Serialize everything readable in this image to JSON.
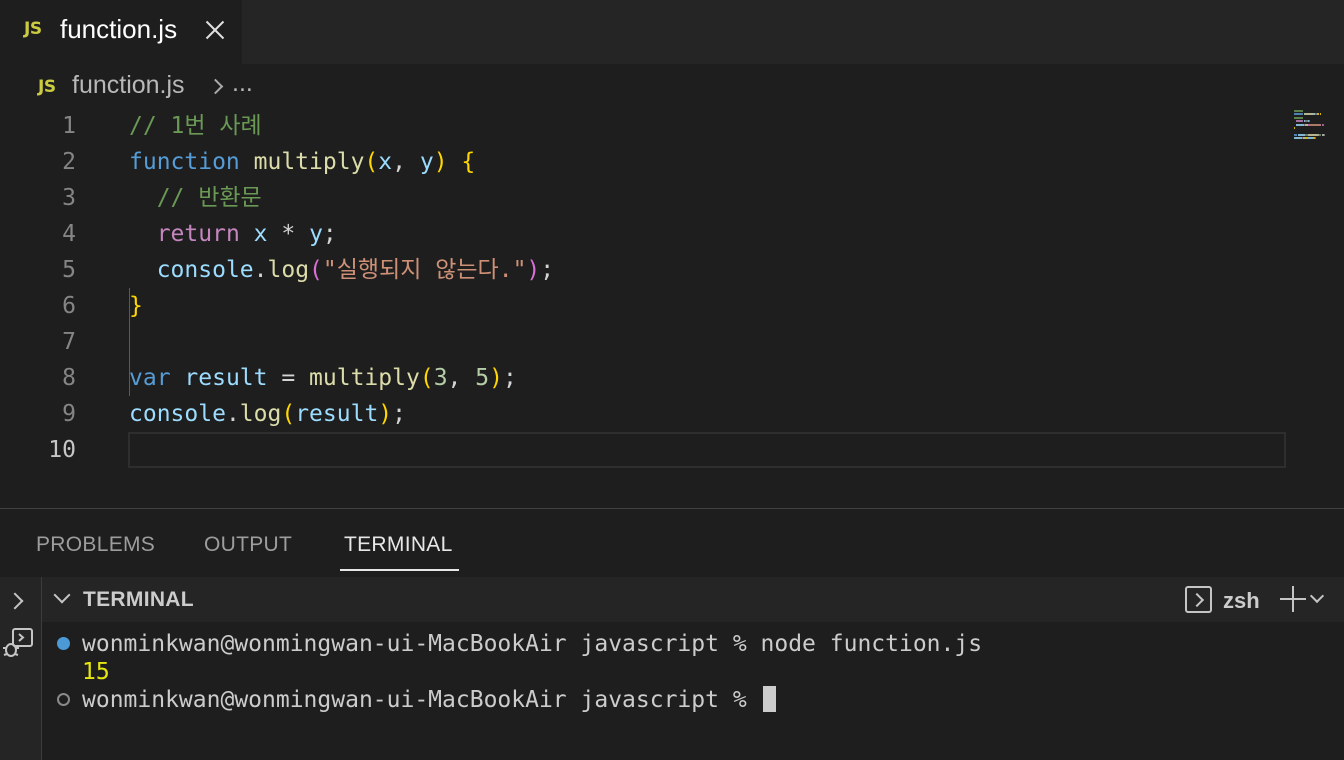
{
  "tab": {
    "badge": "JS",
    "title": "function.js"
  },
  "breadcrumb": {
    "badge": "JS",
    "file": "function.js",
    "more": "..."
  },
  "editor": {
    "line_numbers": [
      "1",
      "2",
      "3",
      "4",
      "5",
      "6",
      "7",
      "8",
      "9",
      "10"
    ],
    "active_line": "10",
    "lines": [
      [
        {
          "t": "// 1번 사례",
          "c": "comment"
        }
      ],
      [
        {
          "t": "function",
          "c": "keyword"
        },
        {
          "t": " ",
          "c": "text"
        },
        {
          "t": "multiply",
          "c": "func"
        },
        {
          "t": "(",
          "c": "brace"
        },
        {
          "t": "x",
          "c": "param"
        },
        {
          "t": ", ",
          "c": "text"
        },
        {
          "t": "y",
          "c": "param"
        },
        {
          "t": ")",
          "c": "brace"
        },
        {
          "t": " ",
          "c": "text"
        },
        {
          "t": "{",
          "c": "brace"
        }
      ],
      [
        {
          "t": "  // 반환문",
          "c": "comment"
        }
      ],
      [
        {
          "t": "  ",
          "c": "text"
        },
        {
          "t": "return",
          "c": "control"
        },
        {
          "t": " ",
          "c": "text"
        },
        {
          "t": "x",
          "c": "param"
        },
        {
          "t": " * ",
          "c": "text"
        },
        {
          "t": "y",
          "c": "param"
        },
        {
          "t": ";",
          "c": "text"
        }
      ],
      [
        {
          "t": "  ",
          "c": "text"
        },
        {
          "t": "console",
          "c": "var"
        },
        {
          "t": ".",
          "c": "text"
        },
        {
          "t": "log",
          "c": "func"
        },
        {
          "t": "(",
          "c": "paren2"
        },
        {
          "t": "\"실행되지 않는다.\"",
          "c": "string"
        },
        {
          "t": ")",
          "c": "paren2"
        },
        {
          "t": ";",
          "c": "text"
        }
      ],
      [
        {
          "t": "}",
          "c": "brace"
        }
      ],
      [],
      [
        {
          "t": "var",
          "c": "keyword"
        },
        {
          "t": " ",
          "c": "text"
        },
        {
          "t": "result",
          "c": "var"
        },
        {
          "t": " = ",
          "c": "text"
        },
        {
          "t": "multiply",
          "c": "func"
        },
        {
          "t": "(",
          "c": "brace"
        },
        {
          "t": "3",
          "c": "num"
        },
        {
          "t": ", ",
          "c": "text"
        },
        {
          "t": "5",
          "c": "num"
        },
        {
          "t": ")",
          "c": "brace"
        },
        {
          "t": ";",
          "c": "text"
        }
      ],
      [
        {
          "t": "console",
          "c": "var"
        },
        {
          "t": ".",
          "c": "text"
        },
        {
          "t": "log",
          "c": "func"
        },
        {
          "t": "(",
          "c": "brace"
        },
        {
          "t": "result",
          "c": "var"
        },
        {
          "t": ")",
          "c": "brace"
        },
        {
          "t": ";",
          "c": "text"
        }
      ],
      []
    ]
  },
  "panel": {
    "tabs": [
      "PROBLEMS",
      "OUTPUT",
      "TERMINAL"
    ],
    "active_tab": "TERMINAL"
  },
  "terminal": {
    "header_title": "TERMINAL",
    "shell": "zsh",
    "prompt_1": "wonminkwan@wonmingwan-ui-MacBookAir javascript % node function.js",
    "output_1": "15",
    "prompt_2": "wonminkwan@wonmingwan-ui-MacBookAir javascript % "
  },
  "colors": {
    "js_badge": "#cbcb41",
    "comment": "#6a9955",
    "keyword": "#569cd6",
    "function": "#dcdcaa",
    "string": "#ce9178",
    "number": "#b5cea8",
    "bracket": "#ffd700",
    "terminal_output": "#e5e510",
    "status_dot": "#4b9ad6"
  },
  "icons": {
    "tab_close": "close-icon",
    "breadcrumb_separator": "chevron-right-icon",
    "panel_toggle": "chevron-right-icon",
    "debug_console": "debug-console-icon",
    "terminal_collapse": "chevron-down-icon",
    "shell_type": "terminal-shell-icon",
    "new_terminal": "plus-icon",
    "terminal_dropdown": "chevron-down-icon"
  }
}
